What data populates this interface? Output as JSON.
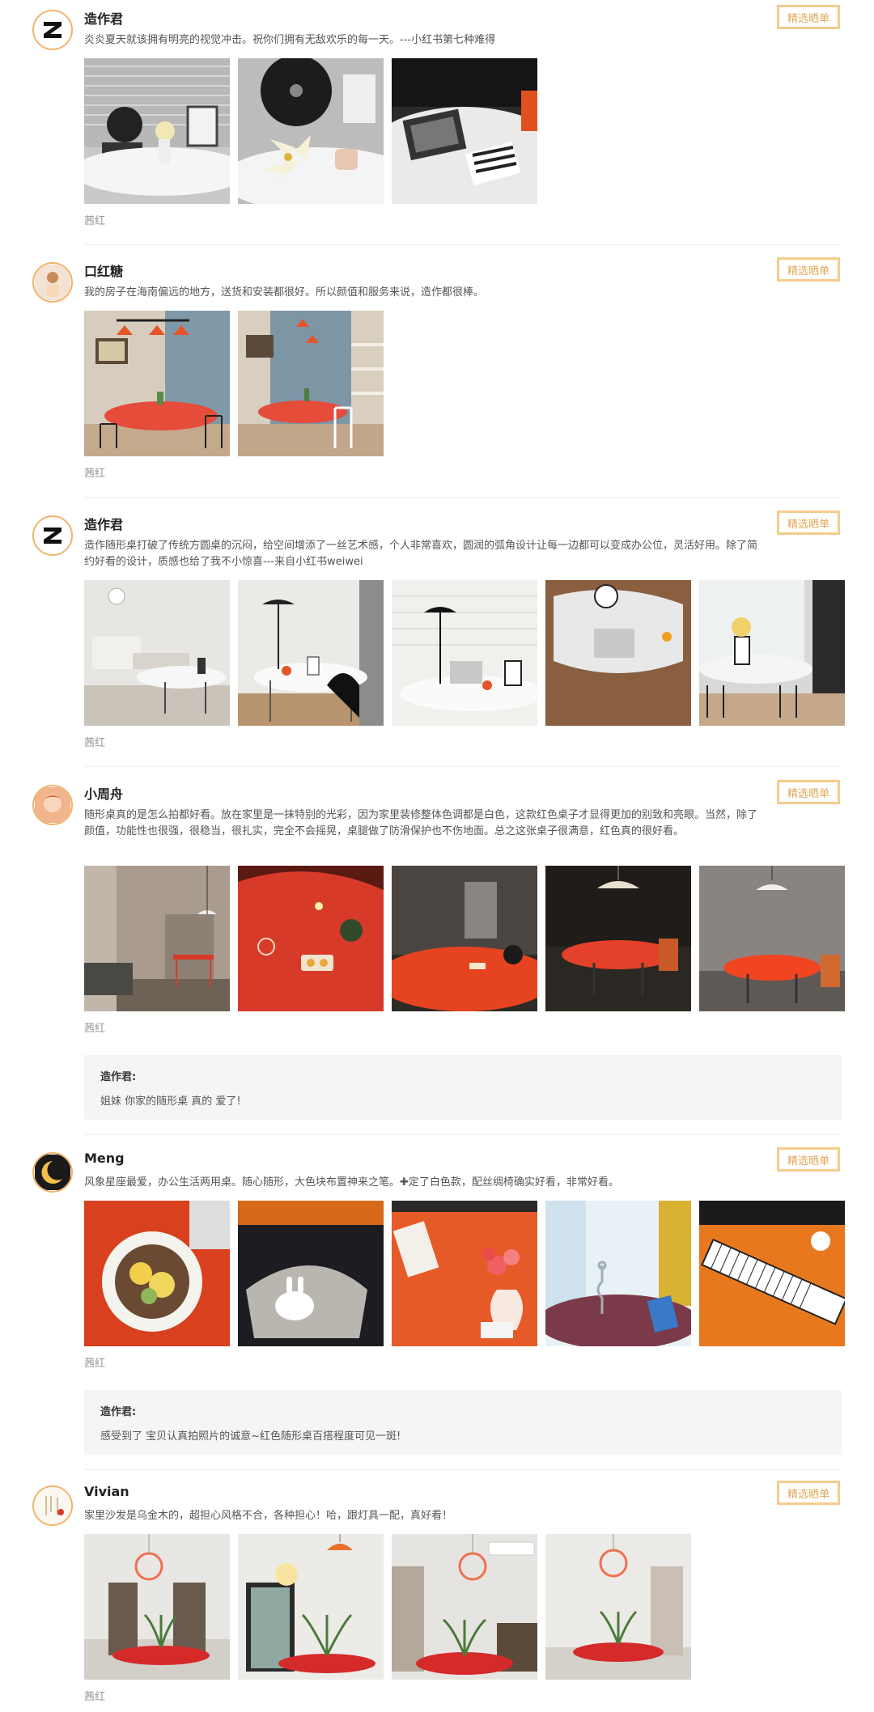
{
  "reviews": [
    {
      "user": "造作君",
      "text": "炎炎夏天就该拥有明亮的视觉冲击。祝你们拥有无敌欢乐的每一天。---小红书第七种难得",
      "tag_button": "精选晒单",
      "color": "茜红",
      "photos": [
        "vinyl-player-shelf-photo",
        "lily-vinyl-closeup-photo",
        "magazine-table-photo"
      ]
    },
    {
      "user": "口红糖",
      "text": "我的房子在海南偏远的地方，送货和安装都很好。所以颜值和服务来说，造作都很棒。",
      "tag_button": "精选晒单",
      "color": "茜红",
      "photos": [
        "dining-room-pendant-photo",
        "dining-room-shelves-photo"
      ]
    },
    {
      "user": "造作君",
      "text": "造作随形桌打破了传统方圆桌的沉闷，给空间增添了一丝艺术感，个人非常喜欢，圆润的弧角设计让每一边都可以变成办公位，灵活好用。除了简约好看的设计，质感也给了我不小惊喜---来自小红书weiwei",
      "tag_button": "精选晒单",
      "color": "茜红",
      "photos": [
        "living-room-table-photo",
        "table-black-chair-photo",
        "table-laptop-lamp-photo",
        "laptop-topdown-photo",
        "window-table-photo"
      ]
    },
    {
      "user": "小周舟",
      "text": "随形桌真的是怎么拍都好看。放在家里是一抹特别的光彩，因为家里装修整体色调都是白色，这款红色桌子才显得更加的别致和亮眼。当然，除了颜值，功能性也很强，很稳当，很扎实，完全不会摇晃，桌腿做了防滑保护也不伤地面。总之这张桌子很满意，红色真的很好看。",
      "tag_button": "精选晒单",
      "color": "茜红",
      "reply_name": "造作君:",
      "reply_text": "姐妹 你家的随形桌 真的 爱了!",
      "photos": [
        "dining-room-wide-photo",
        "red-table-closeup-photo",
        "red-table-dark-photo",
        "red-table-lamp-photo",
        "red-table-evening-photo"
      ]
    },
    {
      "user": "Meng",
      "text": "风象星座最爱，办公生活两用桌。随心随形，大色块布置神来之笔。✚定了白色款，配丝绸椅确实好看，非常好看。",
      "tag_button": "精选晒单",
      "color": "茜红",
      "reply_name": "造作君:",
      "reply_text": "感受到了 宝贝认真拍照片的诚意~红色随形桌百搭程度可见一斑!",
      "photos": [
        "breakfast-plate-photo",
        "bunny-lamp-photo",
        "flower-vase-photo",
        "candle-holder-photo",
        "piano-keyboard-photo"
      ]
    },
    {
      "user": "Vivian",
      "text": "家里沙发是乌金木的，超担心风格不合，各种担心！哈，跟灯具一配，真好看！",
      "tag_button": "精选晒单",
      "color": "茜红",
      "photos": [
        "hall-pendant-photo",
        "window-view-photo",
        "ac-room-photo",
        "white-room-photo"
      ]
    }
  ],
  "colors": {
    "accent": "#f4cc8e",
    "accent_text": "#e0a85a",
    "table_red": "#d83a2a"
  }
}
